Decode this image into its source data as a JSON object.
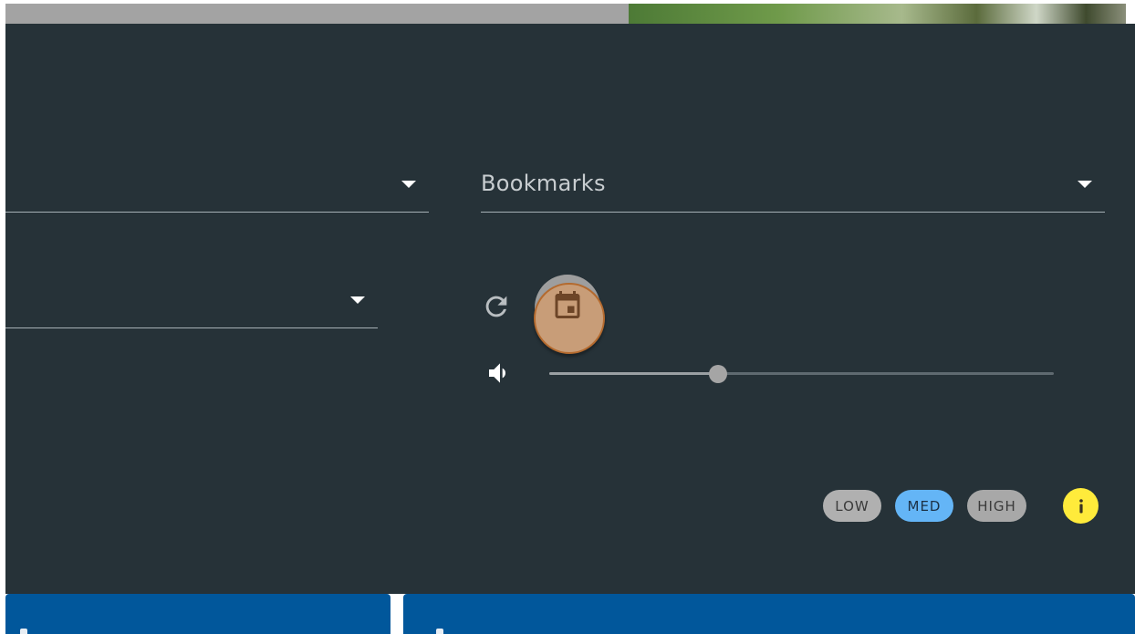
{
  "selects": {
    "select_1": {
      "label": ""
    },
    "bookmarks": {
      "label": "Bookmarks"
    },
    "select_2": {
      "label": ""
    }
  },
  "icons": {
    "refresh": "refresh-icon",
    "calendar": "calendar-icon",
    "volume": "volume-icon",
    "info": "info-icon",
    "dropdown": "arrow-drop-down-icon"
  },
  "volume": {
    "level_percent": 33.5
  },
  "chips": [
    {
      "label": "LOW",
      "selected": false
    },
    {
      "label": "MED",
      "selected": true
    },
    {
      "label": "HIGH",
      "selected": false
    }
  ],
  "colors": {
    "panel_bg": "#263238",
    "card_bg": "#01579b",
    "calendar_button": "#c89d78",
    "chip_selected": "#64b5f6",
    "chip_default": "#b0b0b0",
    "info_badge": "#ffeb3b"
  }
}
